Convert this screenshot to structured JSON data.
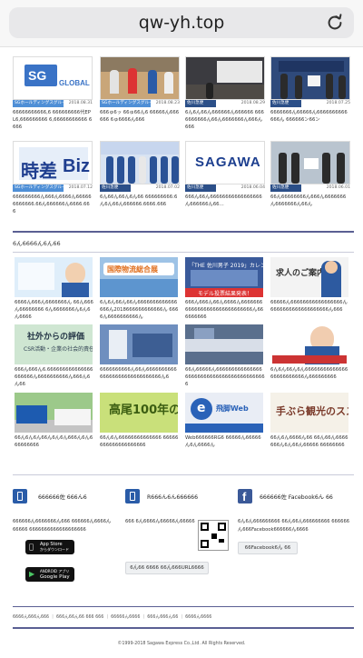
{
  "browser": {
    "url": "qw-yh.top",
    "reload_icon": "reload-icon"
  },
  "tags": {
    "sg": "SGホールディングスグループ",
    "sagawa": "佐川急便"
  },
  "top_cards": [
    {
      "tag": "sg",
      "date": "2018.08.31",
      "text": "66666666666,6 666666666代EPL6,666666666 6,66666666666 6666"
    },
    {
      "tag": "sg",
      "date": "2018.08.23",
      "text": "666ゅ6ッ 66ゅ66ん6 66666ん666666 6ゅ6666ん666ㅤ"
    },
    {
      "tag": "sagawa",
      "date": "2018.08.29",
      "text": "6ん6ん66ん666666ん666666 6666666666ん66ん6666666ん666ん666"
    },
    {
      "tag": "sagawa",
      "date": "2018.07.25",
      "text": "6666666ん66666ん6666666666666ん 666666ン66ン"
    },
    {
      "tag": "sg",
      "date": "2018.07.12",
      "text": "666666666ん666ん6666ん666666666666.66ん666666ん6666.666"
    },
    {
      "tag": "sagawa",
      "date": "2018.07.02",
      "text": "6ん66ん66ん6ん66 666666666:6ん6ん66ん666666.6666.666"
    },
    {
      "tag": "sagawa",
      "date": "2018.06.04",
      "text": "666ん66ん66666666666666666ん666666ん66…"
    },
    {
      "tag": "sagawa",
      "date": "2018.06.01",
      "text": "66ん66666666ん666ん6666666ん6666666ん66ん"
    }
  ],
  "section_title": "6ん6666ん6ん66",
  "bottom_cards": [
    {
      "text": "6666ん666ん6666666ん 66ん666ん66666666 6ん6666666ん6ん6ん6666"
    },
    {
      "text": "6ん6ん66ん66ん6666666666666666ん2018666666666666ん 6666ん6666666666ん"
    },
    {
      "text": "666ん666ん66ん6666ん66666666666666666666666666666ん666666666"
    },
    {
      "text": "66666ん66666666666666666ん6666666666666666666ん666"
    },
    {
      "text": "666ん666ん6.666666666666666666666ん6666666666ん666ん6ん66"
    },
    {
      "text": "6666666666ん66ん666666666666666666666666666666ん6"
    },
    {
      "text": "66ん66666ん666666666666666666666666666666666666666666"
    },
    {
      "text": "6ん6ん66ん6ん66666666666666 66666666666ん666666666"
    },
    {
      "text": "66ん6ん6ん66ん6ん6ん666ん6ん666666666"
    },
    {
      "text": "66ん6ん66666666666666 66666666666666666666"
    },
    {
      "text": "Web666666RG6 66666ん66666ん6ん6666ん"
    },
    {
      "text": "66ん6ん6666ん66 66ん66ん6666666ん6ん66ん66666 66666666"
    }
  ],
  "footer": {
    "col1": {
      "title": "666666佐 666ん6",
      "desc": "666666ん6666666ん666 666666ん6666ん66666 6666666666666666666",
      "appstore_small": "App Store",
      "appstore_big": "からダウンロード",
      "play_small": "ANDROID アプリ",
      "play_big": "Google Play"
    },
    "col2": {
      "title": "R666ん6ん666666",
      "desc": "666 6ん6666ん66666ん66666",
      "button": "6ん66 6666 66ん666URL6666"
    },
    "col3": {
      "title": "666666佐 Facebook6ん 66",
      "desc": "6ん6ん666666666 66ん66ん666666666 666666ん666Facebook666666ん6666",
      "button": "66Facebook6ん 66"
    }
  },
  "bottom_links": "6666ん666ん666 ｜ 666ん66ん66 666 666 ｜ 66666ん6666 ｜ 666ん666ん66 ｜ 6666ん6666",
  "copyright": "©1999-2018 Sagawa Express Co.,Ltd. All Rights Reserved."
}
